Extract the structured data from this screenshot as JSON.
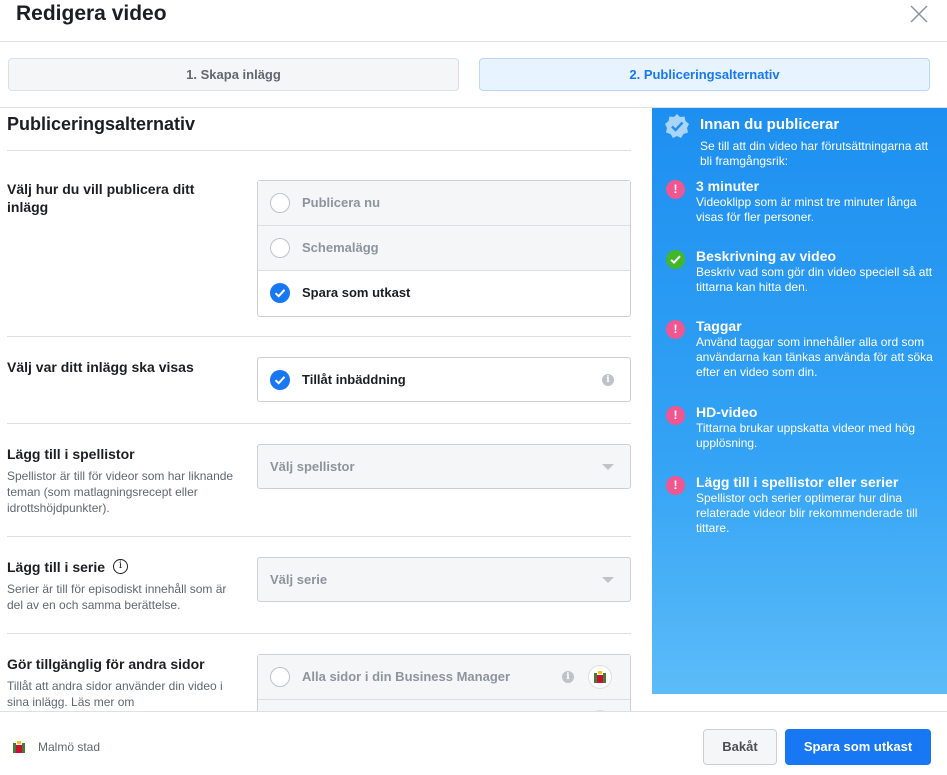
{
  "dialog": {
    "title": "Redigera video"
  },
  "steps": [
    {
      "label": "1. Skapa inlägg",
      "active": false
    },
    {
      "label": "2. Publiceringsalternativ",
      "active": true
    }
  ],
  "main": {
    "section_title": "Publiceringsalternativ",
    "publish": {
      "label": "Välj hur du vill publicera ditt inlägg",
      "options": [
        {
          "label": "Publicera nu",
          "selected": false
        },
        {
          "label": "Schemalägg",
          "selected": false
        },
        {
          "label": "Spara som utkast",
          "selected": true
        }
      ]
    },
    "display": {
      "label": "Välj var ditt inlägg ska visas",
      "embed_label": "Tillåt inbäddning",
      "embed_checked": true
    },
    "playlists": {
      "label": "Lägg till i spellistor",
      "description": "Spellistor är till för videor som har liknande teman (som matlagningsrecept eller idrottshöjdpunkter).",
      "placeholder": "Välj spellistor"
    },
    "series": {
      "label": "Lägg till i serie",
      "description": "Serier är till för episodiskt innehåll som är del av en och samma berättelse.",
      "placeholder": "Välj serie"
    },
    "other_pages": {
      "label": "Gör tillgänglig för andra sidor",
      "description": "Tillåt att andra sidor använder din video i sina inlägg. Läs mer om",
      "option_label": "Alla sidor i din Business Manager"
    }
  },
  "sidebar": {
    "title": "Innan du publicerar",
    "subtitle": "Se till att din video har förutsättningarna att bli framgångsrik:",
    "tips": [
      {
        "status": "warning",
        "title": "3 minuter",
        "text": "Videoklipp som är minst tre minuter långa visas för fler personer."
      },
      {
        "status": "done",
        "title": "Beskrivning av video",
        "text": "Beskriv vad som gör din video speciell så att tittarna kan hitta den."
      },
      {
        "status": "warning",
        "title": "Taggar",
        "text": "Använd taggar som innehåller alla ord som användarna kan tänkas använda för att söka efter en video som din."
      },
      {
        "status": "warning",
        "title": "HD-video",
        "text": "Tittarna brukar uppskatta videor med hög upplösning."
      },
      {
        "status": "warning",
        "title": "Lägg till i spellistor eller serier",
        "text": "Spellistor och serier optimerar hur dina relaterade videor blir rekommenderade till tittare."
      }
    ]
  },
  "footer": {
    "page_name": "Malmö stad",
    "back_label": "Bakåt",
    "save_label": "Spara som utkast"
  },
  "colors": {
    "accent": "#1877f2",
    "sidebar": "#1d8ff0",
    "warning": "#f0568f",
    "success": "#42b72a"
  }
}
